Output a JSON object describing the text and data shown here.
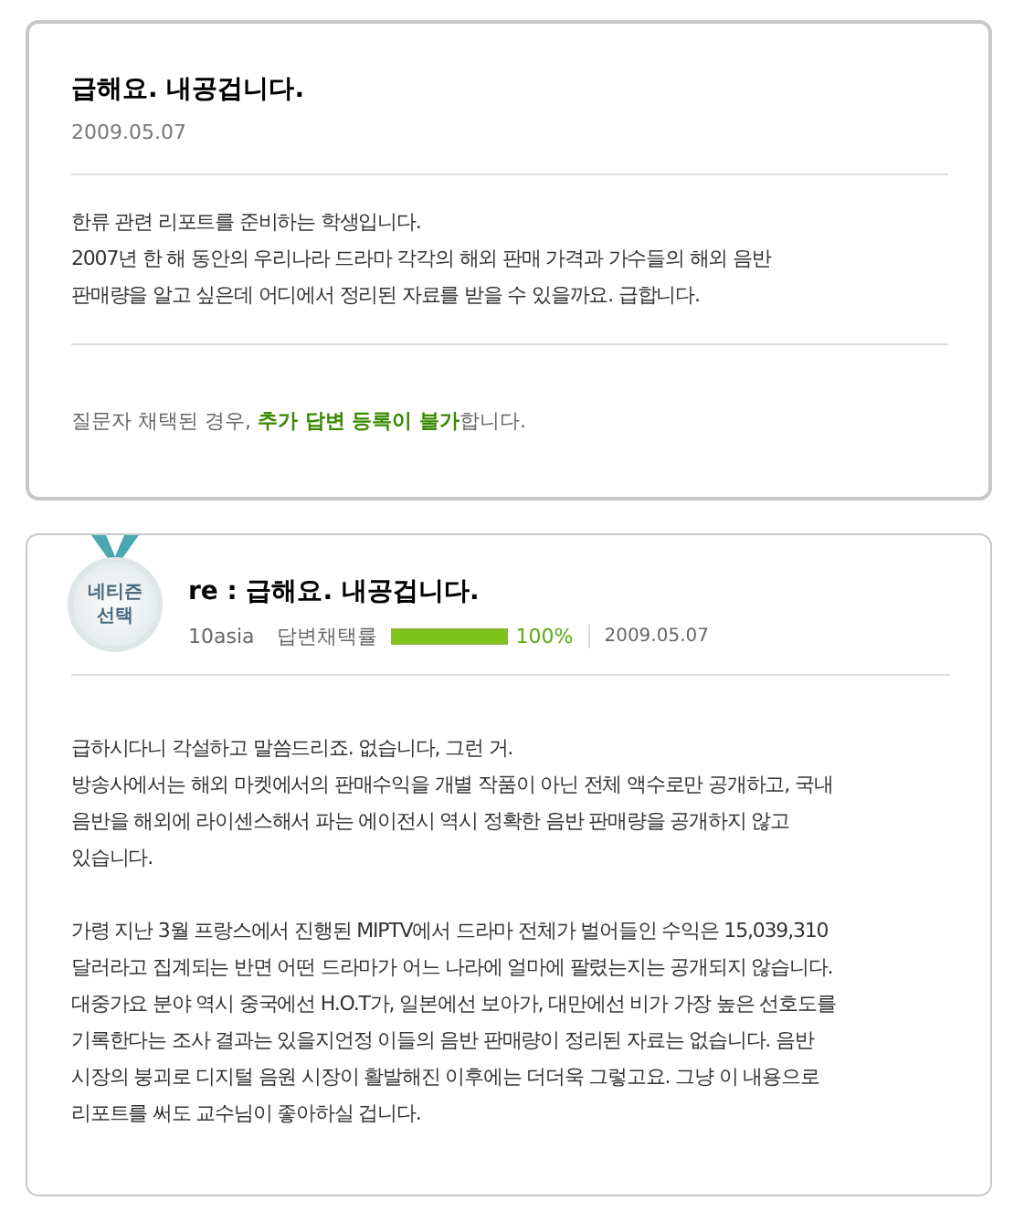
{
  "question": {
    "title": "급해요. 내공겁니다.",
    "date": "2009.05.07",
    "body": "한류 관련 리포트를 준비하는 학생입니다.\n2007년 한 해 동안의 우리나라 드라마 각각의 해외 판매 가격과 가수들의 해외 음반\n판매량을 알고 싶은데 어디에서 정리된 자료를 받을 수 있을까요. 급합니다.",
    "notice": "질문자 채택된 경우, **추가 답변 등록이 불가**합니다."
  },
  "answer": {
    "badge": "네티즌\n선택",
    "title": "re : 급해요. 내공겁니다.",
    "author": "10asia",
    "rate_label": "답변채택률",
    "rate": {
      "level": 1.0
    },
    "rate_text": "100%",
    "date": "2009.05.07",
    "paragraphs": [
      "급하시다니 각설하고 말씀드리죠. 없습니다, 그런 거.\n방송사에서는 해외 마켓에서의 판매수익을 개별 작품이 아닌 전체 액수로만 공개하고, 국내\n음반을 해외에 라이센스해서 파는 에이전시 역시 정확한 음반 판매량을 공개하지 않고\n있습니다.",
      "가령 지난 3월 프랑스에서 진행된 MIPTV에서 드라마 전체가 벌어들인 수익은 15,039,310\n달러라고 집계되는 반면 어떤 드라마가 어느 나라에 얼마에 팔렸는지는 공개되지 않습니다.\n대중가요 분야 역시 중국에선 H.O.T가, 일본에선 보아가, 대만에선 비가 가장 높은 선호도를\n기록한다는 조사 결과는 있을지언정 이들의 음반 판매량이 정리된 자료는 없습니다. 음반\n시장의 붕괴로 디지털 음원 시장이 활발해진 이후에는 더더욱 그렇고요. 그냥 이 내용으로\n리포트를 써도 교수님이 좋아하실 겁니다."
    ]
  }
}
